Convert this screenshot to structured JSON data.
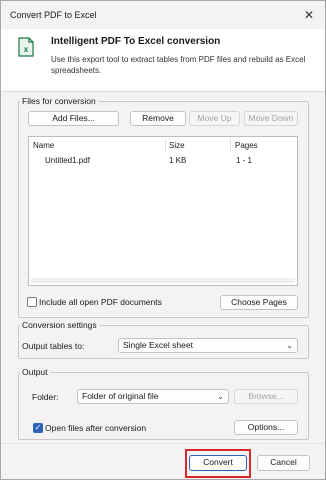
{
  "window": {
    "title": "Convert PDF to Excel",
    "close_glyph": "✕"
  },
  "header": {
    "title": "Intelligent PDF To Excel conversion",
    "description": "Use this export tool to extract tables from PDF files and rebuild as Excel spreadsheets.",
    "icon": "excel-file-icon",
    "icon_color": "#1d7a44"
  },
  "files": {
    "group_label": "Files for conversion",
    "buttons": {
      "add": "Add Files...",
      "remove": "Remove",
      "move_up": "Move Up",
      "move_down": "Move Down"
    },
    "columns": [
      "Name",
      "Size",
      "Pages"
    ],
    "rows": [
      {
        "name": "Untitled1.pdf",
        "size": "1 KB",
        "pages": "1 - 1"
      }
    ],
    "include_all_label": "Include all open PDF documents",
    "include_all_checked": false,
    "choose_pages": "Choose Pages"
  },
  "conversion": {
    "group_label": "Conversion settings",
    "output_tables_label": "Output tables to:",
    "output_tables_value": "Single Excel sheet"
  },
  "output": {
    "group_label": "Output",
    "folder_label": "Folder:",
    "folder_value": "Folder of original file",
    "browse": "Browse...",
    "open_after_label": "Open files after conversion",
    "open_after_checked": true,
    "options": "Options..."
  },
  "footer": {
    "convert": "Convert",
    "cancel": "Cancel"
  },
  "colors": {
    "accent": "#2e62b9",
    "highlight": "#d9272e"
  }
}
